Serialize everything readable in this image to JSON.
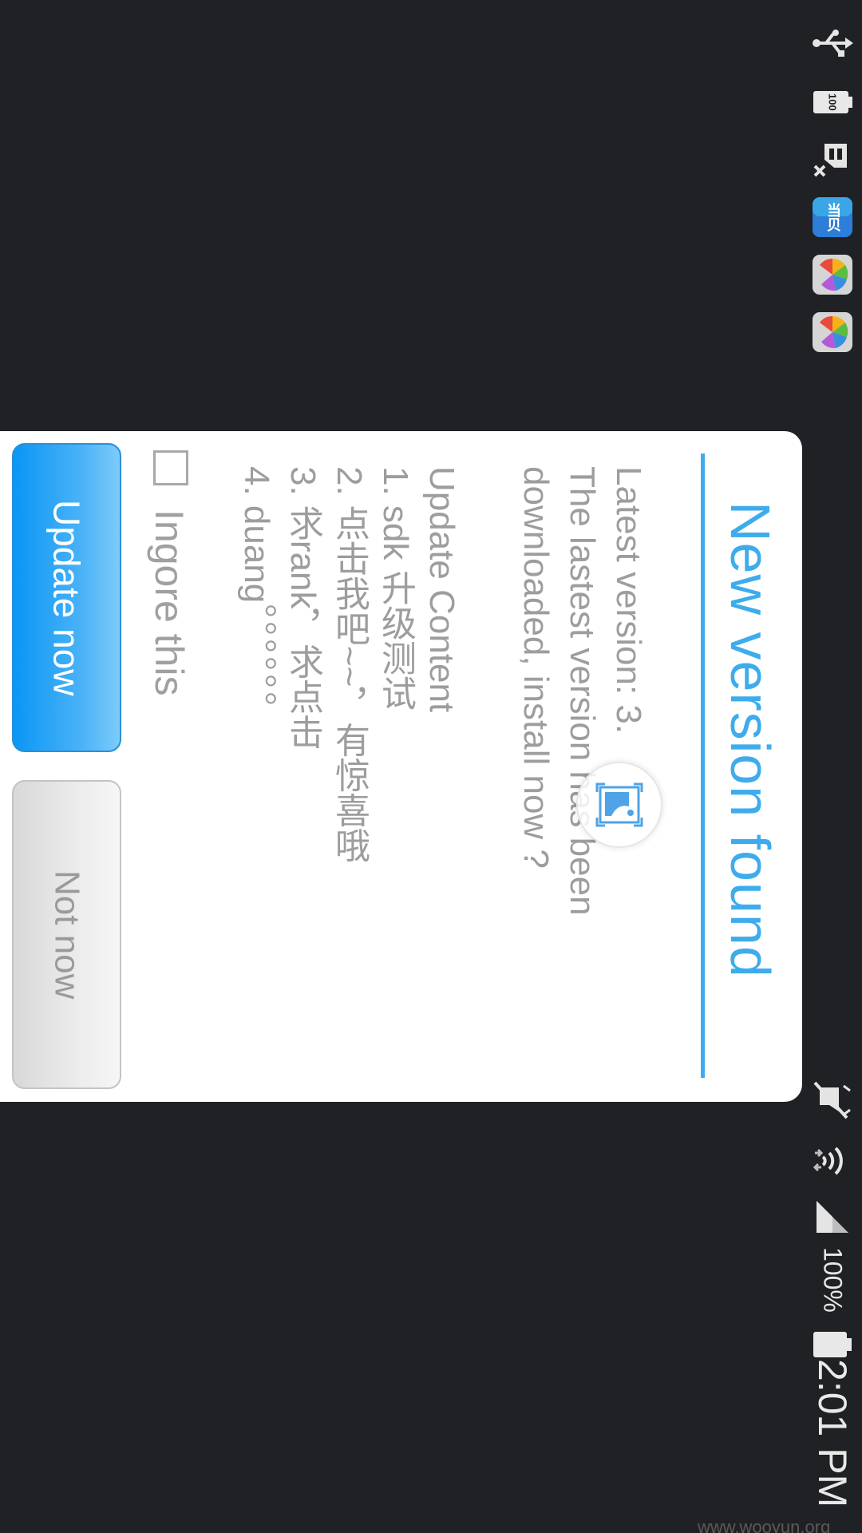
{
  "statusbar": {
    "battery_percent": "100%",
    "time": "2:01 PM",
    "battery_level": 100,
    "notification_badge": "100",
    "news_app_glyph": "当贝",
    "icons": [
      "usb-icon",
      "battery-100-icon",
      "sim-missing-icon",
      "news-app-icon",
      "app-icon-1",
      "app-icon-2",
      "mute-icon",
      "wifi-icon",
      "signal-icon",
      "battery-icon"
    ]
  },
  "dialog": {
    "title": "New version found",
    "latest_version": "Latest version: 3.",
    "message": "The lastest version has been downloaded, install now ?",
    "message_line1": "The lastest version has been",
    "message_line2": "downloaded, install now ?",
    "content_title": "Update Content",
    "items": [
      "1. sdk 升级测试",
      "2. 点击我吧~~，有惊喜哦",
      "3. 求rank，求点击",
      "4. duang。。。。。。"
    ],
    "ignore_label": "Ingore this",
    "ignore_checked": false,
    "update_button": "Update now",
    "not_now_button": "Not now"
  },
  "colors": {
    "accent": "#3eacec",
    "button_primary": "#0a96f5",
    "background": "#202124",
    "text_muted": "#9d9d9d"
  },
  "watermark": "www.wooyun.org"
}
